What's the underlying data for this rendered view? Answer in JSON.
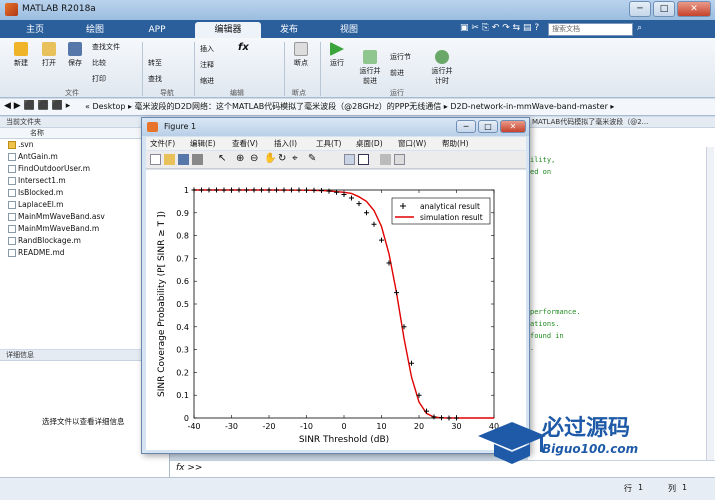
{
  "app": {
    "title": "MATLAB R2018a"
  },
  "tabs": [
    {
      "label": "主页"
    },
    {
      "label": "绘图"
    },
    {
      "label": "APP"
    },
    {
      "label": "编辑器"
    },
    {
      "label": "发布"
    },
    {
      "label": "视图"
    }
  ],
  "search": {
    "placeholder": "搜索文档"
  },
  "ribbon": {
    "new": "新建",
    "open": "打开",
    "save": "保存",
    "find_files": "查找文件",
    "compare": "比较",
    "print": "打印",
    "goto": "转至",
    "find": "查找",
    "insert": "插入",
    "comment": "注释",
    "indent": "缩进",
    "breakpoints": "断点",
    "run": "运行",
    "run_advance": "运行并\n前进",
    "run_section": "运行节",
    "advance": "前进",
    "run_time": "运行并\n计时",
    "group_file": "文件",
    "group_nav": "导航",
    "group_edit": "编辑",
    "group_bp": "断点",
    "group_run": "运行"
  },
  "address": {
    "path": "« Desktop ▸ 毫米波段的D2D网络：这个MATLAB代码模拟了毫米波段（@28GHz）的PPP无线通信 ▸ D2D-network-in-mmWave-band-master ▸"
  },
  "current_folder": {
    "header": "当前文件夹",
    "col_name": "名称",
    "files": [
      ".svn",
      "AntGain.m",
      "FindOutdoorUser.m",
      "Intersect1.m",
      "IsBlocked.m",
      "LaplaceEl.m",
      "MainMmWaveBand.asv",
      "MainMmWaveBand.m",
      "RandBlockage.m",
      "README.md"
    ]
  },
  "details": {
    "header": "详细信息",
    "hint": "选择文件以查看详细信息"
  },
  "editor": {
    "header": "MATLAB代码模拟了毫米波段（@2...",
    "lines": [
      "ility,",
      "ed on",
      "",
      "",
      "",
      "",
      "",
      "",
      "",
      "",
      "",
      "",
      "",
      "performance.",
      "ations.",
      "found in",
      "."
    ]
  },
  "command": {
    "prompt": "fx >>"
  },
  "status": {
    "row_label": "行",
    "row": "1",
    "col_label": "列",
    "col": "1"
  },
  "figure": {
    "title": "Figure 1",
    "menu": [
      "文件(F)",
      "编辑(E)",
      "查看(V)",
      "插入(I)",
      "工具(T)",
      "桌面(D)",
      "窗口(W)",
      "帮助(H)"
    ]
  },
  "watermark": {
    "brand": "必过源码",
    "url": "Biguo100.com"
  },
  "chart_data": {
    "type": "line",
    "title": "",
    "xlabel": "SINR Threshold (dB)",
    "ylabel": "SINR Coverage Probability (P[ SINR ≥ T ])",
    "xlim": [
      -40,
      40
    ],
    "ylim": [
      0,
      1
    ],
    "xticks": [
      -40,
      -30,
      -20,
      -10,
      0,
      10,
      20,
      30,
      40
    ],
    "yticks": [
      0,
      0.1,
      0.2,
      0.3,
      0.4,
      0.5,
      0.6,
      0.7,
      0.8,
      0.9,
      1
    ],
    "legend_position": "top-right",
    "series": [
      {
        "name": "analytical result",
        "style": "markers",
        "color": "#000000",
        "x": [
          -40,
          -38,
          -36,
          -34,
          -32,
          -30,
          -28,
          -26,
          -24,
          -22,
          -20,
          -18,
          -16,
          -14,
          -12,
          -10,
          -8,
          -6,
          -4,
          -2,
          0,
          2,
          4,
          6,
          8,
          10,
          12,
          14,
          16,
          18,
          20,
          22,
          24,
          26,
          28,
          30
        ],
        "y": [
          1,
          1,
          1,
          1,
          1,
          1,
          1,
          1,
          1,
          1,
          1,
          1,
          1,
          1,
          1,
          1,
          0.999,
          0.998,
          0.995,
          0.99,
          0.98,
          0.965,
          0.94,
          0.9,
          0.85,
          0.78,
          0.68,
          0.55,
          0.4,
          0.24,
          0.1,
          0.03,
          0.005,
          0.001,
          0,
          0
        ]
      },
      {
        "name": "simulation result",
        "style": "line",
        "color": "#e00000",
        "x": [
          -40,
          -30,
          -20,
          -10,
          -5,
          0,
          2,
          4,
          6,
          8,
          10,
          12,
          14,
          16,
          18,
          20,
          22,
          24,
          26,
          28,
          30,
          40
        ],
        "y": [
          1,
          1,
          1,
          0.999,
          0.997,
          0.99,
          0.985,
          0.97,
          0.95,
          0.91,
          0.84,
          0.72,
          0.55,
          0.35,
          0.18,
          0.07,
          0.02,
          0.004,
          0.001,
          0,
          0,
          0
        ]
      }
    ]
  }
}
